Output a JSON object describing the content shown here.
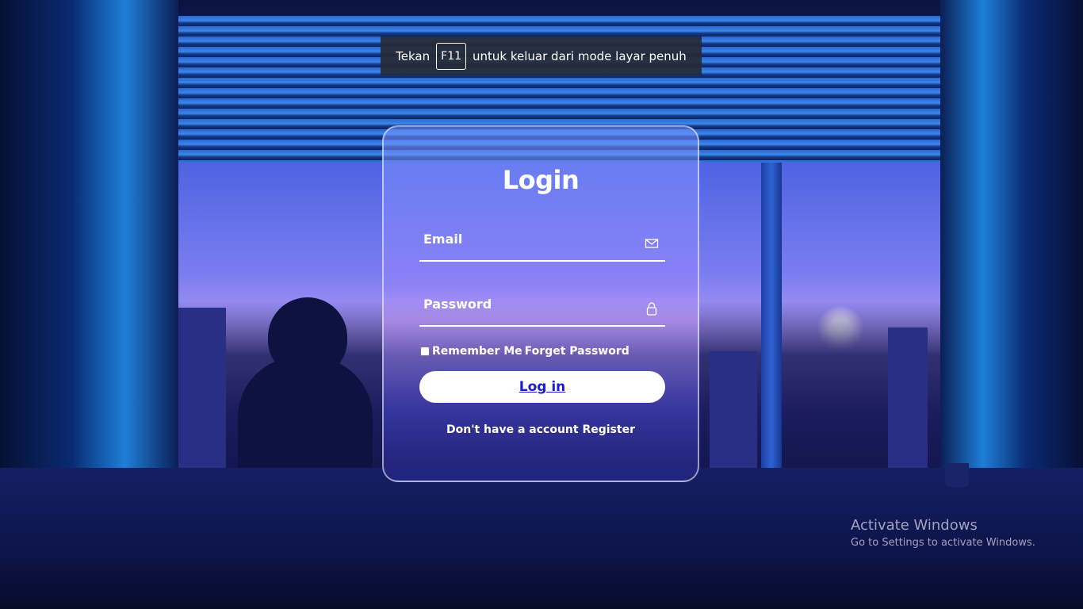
{
  "fullscreen_notice": {
    "prefix": "Tekan",
    "key": "F11",
    "suffix": "untuk keluar dari mode layar penuh"
  },
  "login": {
    "title": "Login",
    "email_placeholder": "Email",
    "email_icon": "envelope-icon",
    "password_placeholder": "Password",
    "password_icon": "lock-icon",
    "remember_label": "Remember Me",
    "forgot_label": "Forget Password",
    "submit_label": "Log in",
    "register_prompt": "Don't have a account",
    "register_link": "Register"
  },
  "watermark": {
    "title": "Activate Windows",
    "subtitle": "Go to Settings to activate Windows."
  },
  "colors": {
    "button_bg": "#ffffff",
    "button_text": "#1a1ad6",
    "card_border": "#ffffff"
  }
}
